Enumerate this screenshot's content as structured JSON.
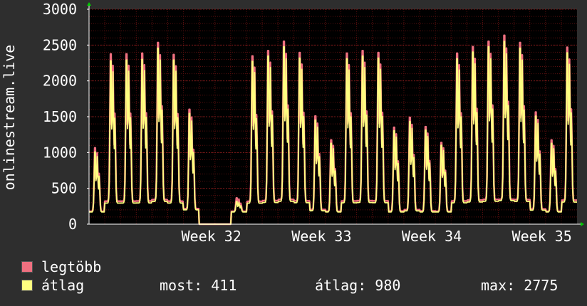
{
  "chart_data": {
    "type": "line",
    "ylabel": "onlinestream.live",
    "ylim": [
      0,
      3000
    ],
    "yticks": [
      0,
      500,
      1000,
      1500,
      2000,
      2500,
      3000
    ],
    "xlim": [
      0,
      31
    ],
    "xticks": [
      {
        "x": 7,
        "label": "Week 32"
      },
      {
        "x": 14,
        "label": "Week 33"
      },
      {
        "x": 21,
        "label": "Week 34"
      },
      {
        "x": 28,
        "label": "Week 35"
      }
    ],
    "grid": true,
    "colors": {
      "background": "#000000",
      "grid": "#5a0f0f",
      "legbobb": "#f07080",
      "atlag": "#ffff80",
      "axis": "#ffffff"
    },
    "series": [
      {
        "name": "legtöbb",
        "color": "#f07080",
        "daily_peaks": [
          1140,
          2550,
          2550,
          2560,
          2720,
          2540,
          1720,
          0,
          0,
          380,
          2520,
          2600,
          2740,
          2570,
          1620,
          1260,
          2560,
          2600,
          2570,
          1450,
          1600,
          1460,
          1220,
          2560,
          2660,
          2740,
          2830,
          2720,
          1680,
          1260,
          2650
        ]
      },
      {
        "name": "átlag",
        "color": "#ffff80",
        "daily_peaks": [
          1080,
          2450,
          2460,
          2470,
          2640,
          2460,
          1660,
          0,
          0,
          330,
          2440,
          2520,
          2660,
          2490,
          1560,
          1210,
          2480,
          2520,
          2490,
          1400,
          1540,
          1410,
          1180,
          2480,
          2580,
          2660,
          2740,
          2640,
          1620,
          1210,
          2570
        ]
      }
    ]
  },
  "legend": {
    "max_label": "legtöbb",
    "avg_label": "átlag",
    "now_label": "most: 411",
    "avg_stat_label": "átlag: 980",
    "max_stat_label": "max: 2775"
  }
}
